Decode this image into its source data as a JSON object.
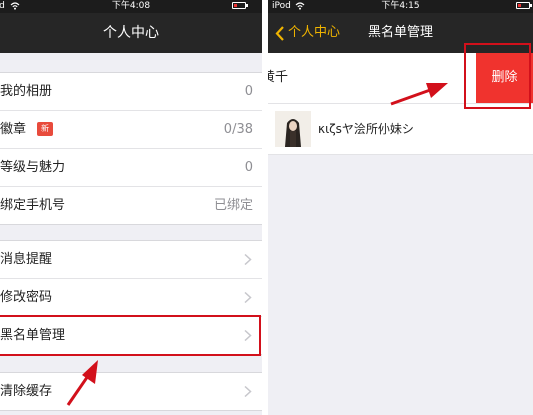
{
  "left_screen": {
    "status_bar": {
      "carrier": "iPod",
      "time": "下午4:08"
    },
    "nav_title": "个人中心",
    "group1": [
      {
        "label": "我的相册",
        "value": "0"
      },
      {
        "label": "徽章",
        "badge": "新",
        "value": "0/38"
      },
      {
        "label": "等级与魅力",
        "value": "0"
      },
      {
        "label": "绑定手机号",
        "value": "已绑定"
      }
    ],
    "group2": [
      {
        "label": "消息提醒"
      },
      {
        "label": "修改密码"
      },
      {
        "label": "黑名单管理"
      }
    ],
    "group3": [
      {
        "label": "清除缓存"
      }
    ]
  },
  "right_screen": {
    "status_bar": {
      "carrier": "iPod",
      "time": "下午4:15"
    },
    "back_label": "个人中心",
    "nav_title": "黑名单管理",
    "blacklist": [
      {
        "name": "黄千"
      },
      {
        "name": "κιζsヤ浍所仦妹シ"
      }
    ],
    "delete_label": "删除"
  },
  "colors": {
    "nav_bg": "#262626",
    "back_label": "#f0b400",
    "delete_bg": "#f0332e",
    "highlight": "#d2101b",
    "badge": "#e84b3c"
  },
  "icons": [
    "wifi-icon",
    "battery-icon",
    "chevron-right-icon",
    "back-chevron-icon",
    "red-arrow"
  ]
}
